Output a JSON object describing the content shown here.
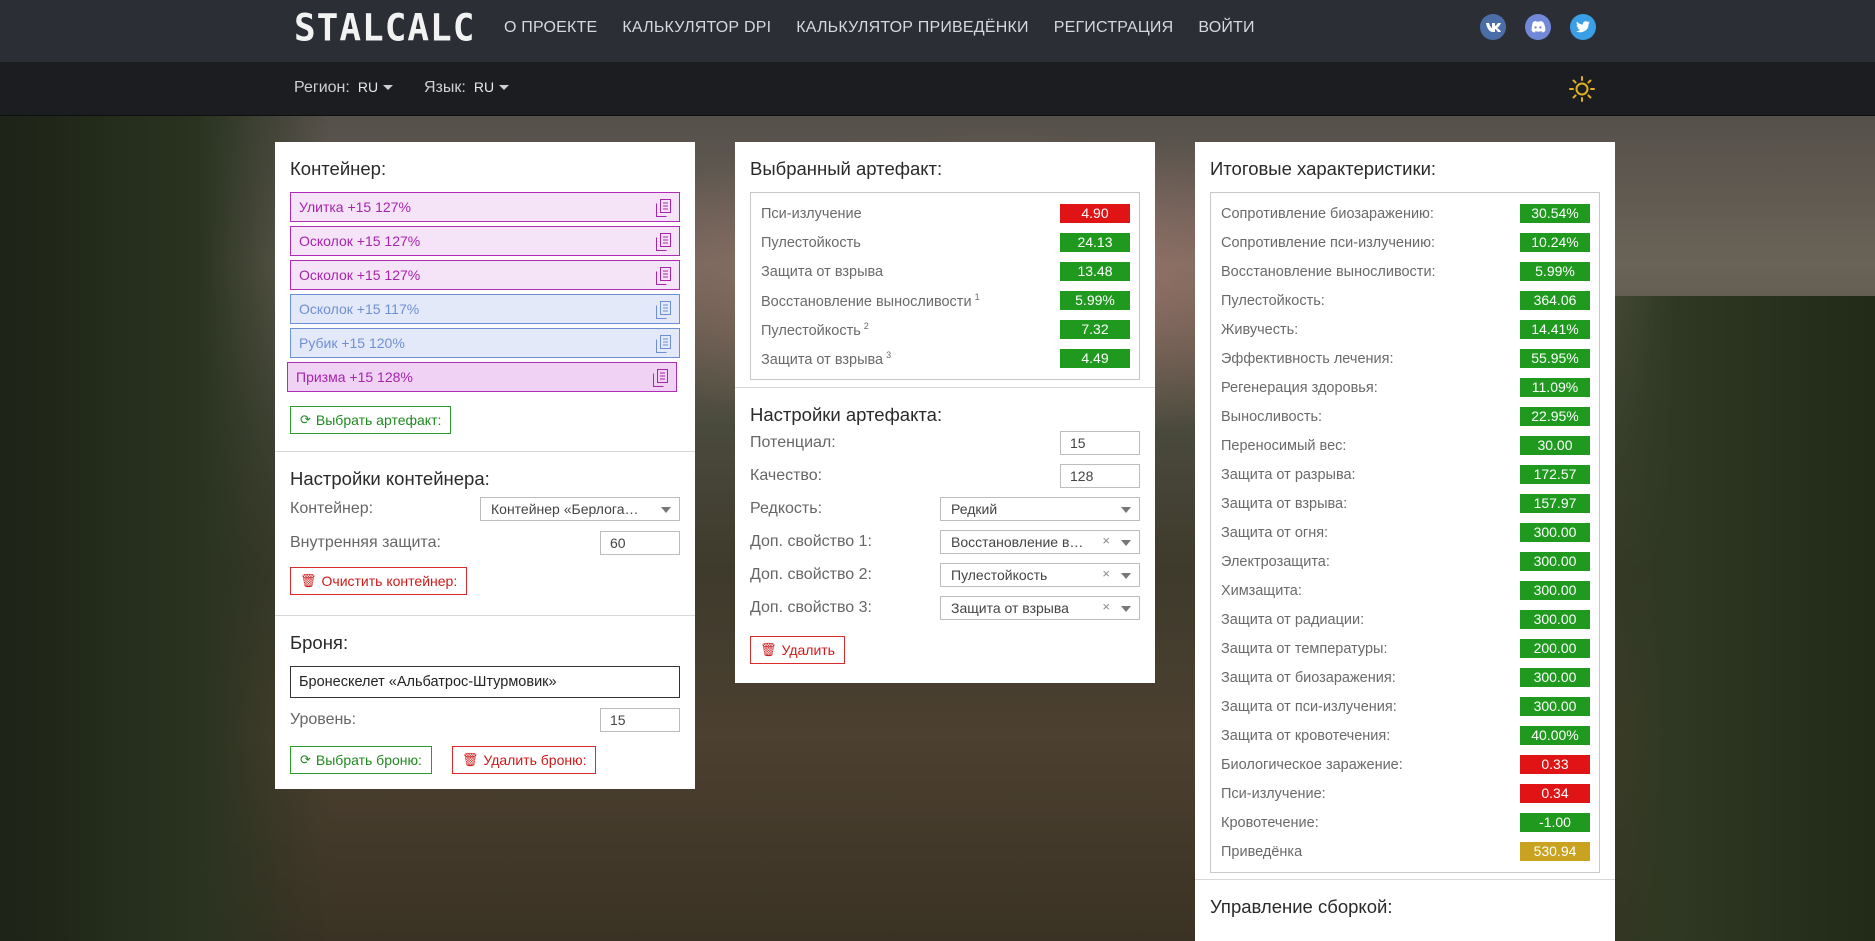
{
  "header": {
    "logo": "STALCALC",
    "nav": [
      "О ПРОЕКТЕ",
      "КАЛЬКУЛЯТОР DPI",
      "КАЛЬКУЛЯТОР ПРИВЕДЁНКИ",
      "РЕГИСТРАЦИЯ",
      "ВОЙТИ"
    ],
    "social": [
      {
        "icon": "vk-icon",
        "text": "vk",
        "color": "#4b6ea8"
      },
      {
        "icon": "discord-icon",
        "text": "d",
        "color": "#7289da"
      },
      {
        "icon": "twitter-icon",
        "text": "t",
        "color": "#3a9fe6"
      }
    ]
  },
  "subbar": {
    "region_label": "Регион:",
    "region_value": "RU",
    "lang_label": "Язык:",
    "lang_value": "RU",
    "theme_icon": "sun-icon",
    "theme_color": "#e0b020"
  },
  "container": {
    "title": "Контейнер:",
    "artifacts": [
      {
        "label": "Улитка +15 127%",
        "style": "purple"
      },
      {
        "label": "Осколок +15 127%",
        "style": "purple"
      },
      {
        "label": "Осколок +15 127%",
        "style": "purple"
      },
      {
        "label": "Осколок +15 117%",
        "style": "blue"
      },
      {
        "label": "Рубик +15 120%",
        "style": "blue"
      },
      {
        "label": "Призма +15 128%",
        "style": "purple2"
      }
    ],
    "choose_button": "Выбрать артефакт:"
  },
  "container_settings": {
    "title": "Настройки контейнера:",
    "container_label": "Контейнер:",
    "container_value": "Контейнер «Берлога…",
    "protection_label": "Внутренняя защита:",
    "protection_value": "60",
    "clear_button": "Очистить контейнер:"
  },
  "armor": {
    "title": "Броня:",
    "name": "Бронескелет «Альбатрос-Штурмовик»",
    "level_label": "Уровень:",
    "level_value": "15",
    "choose_button": "Выбрать броню:",
    "remove_button": "Удалить броню:"
  },
  "selected_artifact": {
    "title": "Выбранный артефакт:",
    "stats": [
      {
        "label": "Пси-излучение",
        "sup": "",
        "value": "4.90",
        "color": "red"
      },
      {
        "label": "Пулестойкость",
        "sup": "",
        "value": "24.13",
        "color": "green"
      },
      {
        "label": "Защита от взрыва",
        "sup": "",
        "value": "13.48",
        "color": "green"
      },
      {
        "label": "Восстановление выносливости",
        "sup": "1",
        "value": "5.99%",
        "color": "green"
      },
      {
        "label": "Пулестойкость",
        "sup": "2",
        "value": "7.32",
        "color": "green"
      },
      {
        "label": "Защита от взрыва",
        "sup": "3",
        "value": "4.49",
        "color": "green"
      }
    ]
  },
  "artifact_settings": {
    "title": "Настройки артефакта:",
    "potential_label": "Потенциал:",
    "potential_value": "15",
    "quality_label": "Качество:",
    "quality_value": "128",
    "rarity_label": "Редкость:",
    "rarity_value": "Редкий",
    "prop1_label": "Доп. свойство 1:",
    "prop1_value": "Восстановление в…",
    "prop2_label": "Доп. свойство 2:",
    "prop2_value": "Пулестойкость",
    "prop3_label": "Доп. свойство 3:",
    "prop3_value": "Защита от взрыва",
    "delete_button": "Удалить"
  },
  "totals": {
    "title": "Итоговые характеристики:",
    "stats": [
      {
        "label": "Сопротивление биозаражению:",
        "value": "30.54%",
        "color": "green"
      },
      {
        "label": "Сопротивление пси-излучению:",
        "value": "10.24%",
        "color": "green"
      },
      {
        "label": "Восстановление выносливости:",
        "value": "5.99%",
        "color": "green"
      },
      {
        "label": "Пулестойкость:",
        "value": "364.06",
        "color": "green"
      },
      {
        "label": "Живучесть:",
        "value": "14.41%",
        "color": "green"
      },
      {
        "label": "Эффективность лечения:",
        "value": "55.95%",
        "color": "green"
      },
      {
        "label": "Регенерация здоровья:",
        "value": "11.09%",
        "color": "green"
      },
      {
        "label": "Выносливость:",
        "value": "22.95%",
        "color": "green"
      },
      {
        "label": "Переносимый вес:",
        "value": "30.00",
        "color": "green"
      },
      {
        "label": "Защита от разрыва:",
        "value": "172.57",
        "color": "green"
      },
      {
        "label": "Защита от взрыва:",
        "value": "157.97",
        "color": "green"
      },
      {
        "label": "Защита от огня:",
        "value": "300.00",
        "color": "green"
      },
      {
        "label": "Электрозащита:",
        "value": "300.00",
        "color": "green"
      },
      {
        "label": "Химзащита:",
        "value": "300.00",
        "color": "green"
      },
      {
        "label": "Защита от радиации:",
        "value": "300.00",
        "color": "green"
      },
      {
        "label": "Защита от температуры:",
        "value": "200.00",
        "color": "green"
      },
      {
        "label": "Защита от биозаражения:",
        "value": "300.00",
        "color": "green"
      },
      {
        "label": "Защита от пси-излучения:",
        "value": "300.00",
        "color": "green"
      },
      {
        "label": "Защита от кровотечения:",
        "value": "40.00%",
        "color": "green"
      },
      {
        "label": "Биологическое заражение:",
        "value": "0.33",
        "color": "red"
      },
      {
        "label": "Пси-излучение:",
        "value": "0.34",
        "color": "red"
      },
      {
        "label": "Кровотечение:",
        "value": "-1.00",
        "color": "green"
      },
      {
        "label": "Приведёнка",
        "value": "530.94",
        "color": "gold"
      }
    ]
  },
  "build": {
    "title": "Управление сборкой:"
  }
}
